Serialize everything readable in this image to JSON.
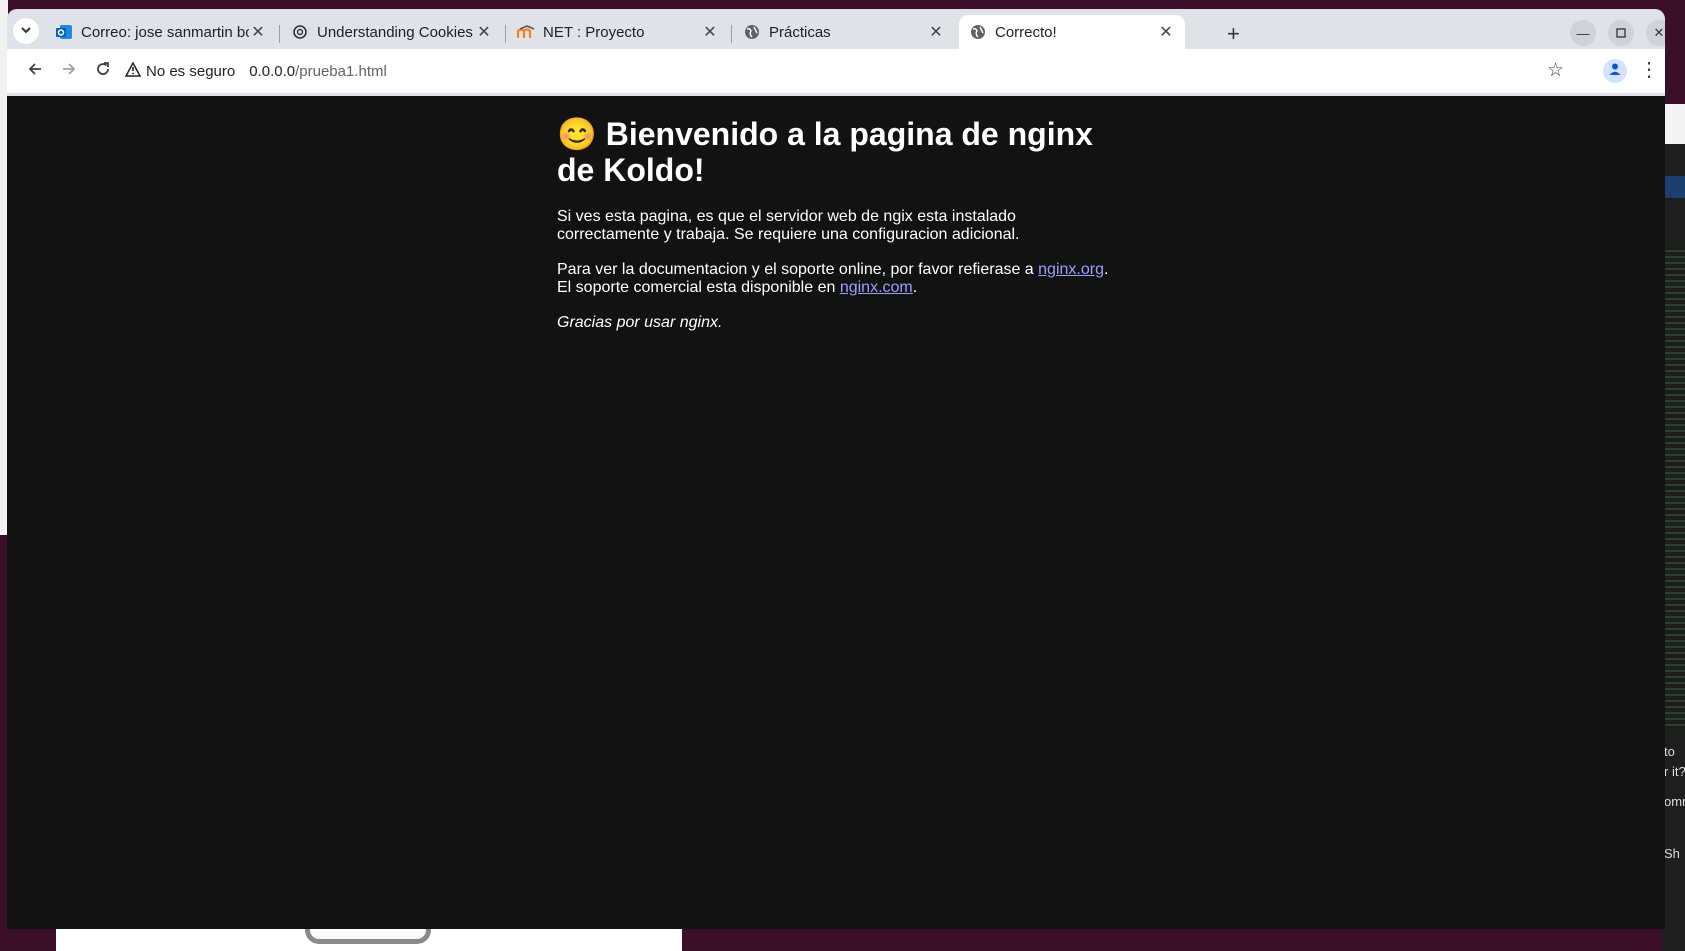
{
  "browser": {
    "tabs": [
      {
        "title": "Correo: jose sanmartin bo",
        "icon": "outlook-icon",
        "active": false
      },
      {
        "title": "Understanding Cookies B",
        "icon": "openai-icon",
        "active": false
      },
      {
        "title": "NET : Proyecto",
        "icon": "moodle-icon",
        "active": false
      },
      {
        "title": "Prácticas",
        "icon": "globe-icon",
        "active": false
      },
      {
        "title": "Correcto!",
        "icon": "globe-icon",
        "active": true
      }
    ],
    "new_tab_glyph": "+",
    "security_label": "No es seguro",
    "url_host": "0.0.0.0",
    "url_path": "/prueba1.html"
  },
  "page": {
    "heading_line1": "😊 Bienvenido a la pagina de nginx",
    "heading_line2": "de Koldo!",
    "para1_line1": "Si ves esta pagina, es que el servidor web de ngix esta instalado",
    "para1_line2": "correctamente y trabaja. Se requiere una configuracion adicional.",
    "para2_prefix": "Para ver la documentacion y el soporte online, por favor refierase a ",
    "para2_link1": "nginx.org",
    "para2_mid": "El soporte comercial esta disponible en ",
    "para2_link2": "nginx.com",
    "thanks": "Gracias por usar nginx."
  },
  "desktop": {
    "right_text_1": "to",
    "right_text_2": "r it?",
    "right_text_3": "omn",
    "right_text_4": "Sh"
  },
  "colors": {
    "page_background": "#121212",
    "link": "#9e9eff",
    "tabstrip": "#dfe3e8",
    "desktop": "#3b0f2a"
  }
}
